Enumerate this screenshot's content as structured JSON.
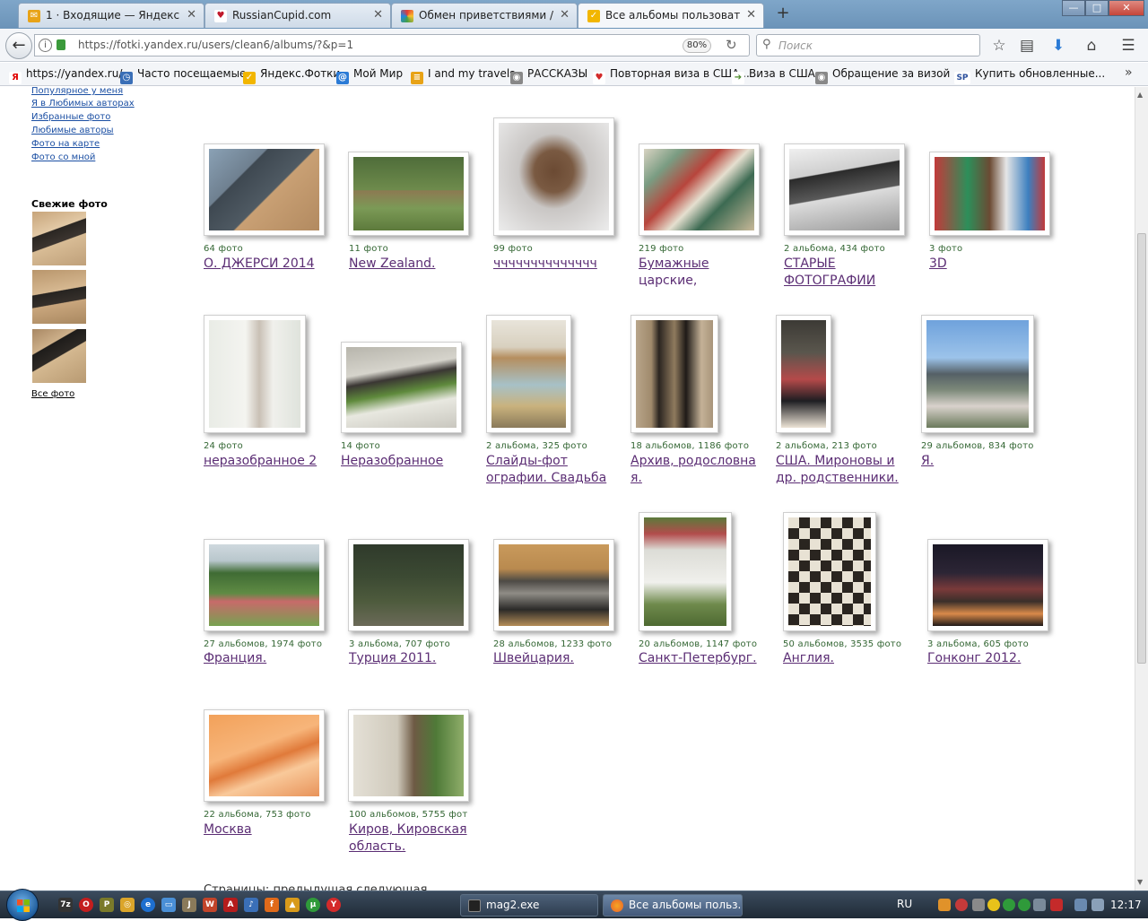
{
  "tabs": [
    {
      "title": "1 · Входящие — Яндекс.П...",
      "icon": "mail-icon",
      "color": "#e8a317"
    },
    {
      "title": "RussianCupid.com",
      "icon": "heart-icon",
      "color": "#c0192b"
    },
    {
      "title": "Обмен приветствиями / К...",
      "icon": "pinwheel-icon",
      "color": "#7b4bb5"
    },
    {
      "title": "Все альбомы пользовате...",
      "icon": "yandex-fotki-icon",
      "color": "#f2b600"
    }
  ],
  "tab_close": "✕",
  "new_tab": "+",
  "window_buttons": {
    "minimize": "—",
    "maximize": "□",
    "close": "✕"
  },
  "nav": {
    "back": "←",
    "url": "https://fotki.yandex.ru/users/clean6/albums/?&p=1",
    "zoom": "80%",
    "reload": "↻",
    "search_placeholder": "Поиск",
    "icons": [
      "bookmark-star-icon",
      "library-icon",
      "download-icon",
      "home-icon",
      "menu-icon"
    ]
  },
  "bookmarks": [
    {
      "label": "https://yandex.ru/",
      "color": "#e00000",
      "glyph": "Я"
    },
    {
      "label": "Часто посещаемые",
      "color": "#3a6fb7",
      "glyph": "◷"
    },
    {
      "label": "Яндекс.Фотки",
      "color": "#f2b600",
      "glyph": "✓"
    },
    {
      "label": "Мой Мир",
      "color": "#2b7bd6",
      "glyph": "@"
    },
    {
      "label": "I and my travels",
      "color": "#e8a317",
      "glyph": "≡"
    },
    {
      "label": "РАССКАЗЫ",
      "color": "#777777",
      "glyph": "◉"
    },
    {
      "label": "Повторная виза в США...",
      "color": "#d22a2a",
      "glyph": "♥"
    },
    {
      "label": "Виза в США",
      "color": "#4a8a2a",
      "glyph": "➔"
    },
    {
      "label": "Обращение за визой ...",
      "color": "#777777",
      "glyph": "◉"
    },
    {
      "label": "Купить обновленные...",
      "color": "#2b4f9c",
      "glyph": "SP"
    }
  ],
  "bookmarks_more": "»",
  "sidebar": {
    "links": [
      "Популярное у меня",
      "Я в Любимых авторах",
      "Избранные фото",
      "Любимые авторы",
      "Фото на карте",
      "Фото со мной"
    ],
    "fresh_title": "Свежие фото",
    "all_photos": "Все фото"
  },
  "albums": [
    {
      "count": "64 фото",
      "title": "О. ДЖЕРСИ 2014"
    },
    {
      "count": "11 фото",
      "title": "New Zealand."
    },
    {
      "count": "99 фото",
      "title": "чччччччччччччч"
    },
    {
      "count": "219 фото",
      "title": "Бумажные",
      "title2": "царские,"
    },
    {
      "count": "2 альбома, 434 фото",
      "title": "СТАРЫЕ",
      "title2": "ФОТОГРАФИИ"
    },
    {
      "count": "3 фото",
      "title": "3D"
    },
    {
      "count": "24 фото",
      "title": "неразобранное 2"
    },
    {
      "count": "14 фото",
      "title": "Неразобранное"
    },
    {
      "count": "2 альбома, 325 фото",
      "title": "Слайды-фот",
      "title2": "ографии. Свадьба"
    },
    {
      "count": "18 альбомов, 1186 фото",
      "title": "Архив, родословна",
      "title2": "я."
    },
    {
      "count": "2 альбома, 213 фото",
      "title": "США. Мироновы и",
      "title2": "др. родственники."
    },
    {
      "count": "29 альбомов, 834 фото",
      "title": "Я."
    },
    {
      "count": "27 альбомов, 1974 фото",
      "title": "Франция."
    },
    {
      "count": "3 альбома, 707 фото",
      "title": "Турция 2011."
    },
    {
      "count": "28 альбомов, 1233 фото",
      "title": "Швейцария."
    },
    {
      "count": "20 альбомов, 1147 фото",
      "title": "Санкт-Петербург."
    },
    {
      "count": "50 альбомов, 3535 фото",
      "title": "Англия."
    },
    {
      "count": "3 альбома, 605 фото",
      "title": "Гонконг 2012."
    },
    {
      "count": "22 альбома, 753 фото",
      "title": "Москва"
    },
    {
      "count": "100 альбомов, 5755 фот",
      "title": "Киров, Кировская",
      "title2": "область."
    }
  ],
  "pager_cut": "Страницы:      предыдущая    следующая",
  "taskbar": {
    "tasks": [
      {
        "label": "mag2.exe",
        "color": "#222222"
      },
      {
        "label": "Все альбомы польз...",
        "color": "#e8602c"
      }
    ],
    "lang": "RU",
    "clock": "12:17"
  },
  "colors": {
    "link": "#1b4fa3",
    "album_title": "#5b2d74",
    "album_count": "#336633"
  }
}
